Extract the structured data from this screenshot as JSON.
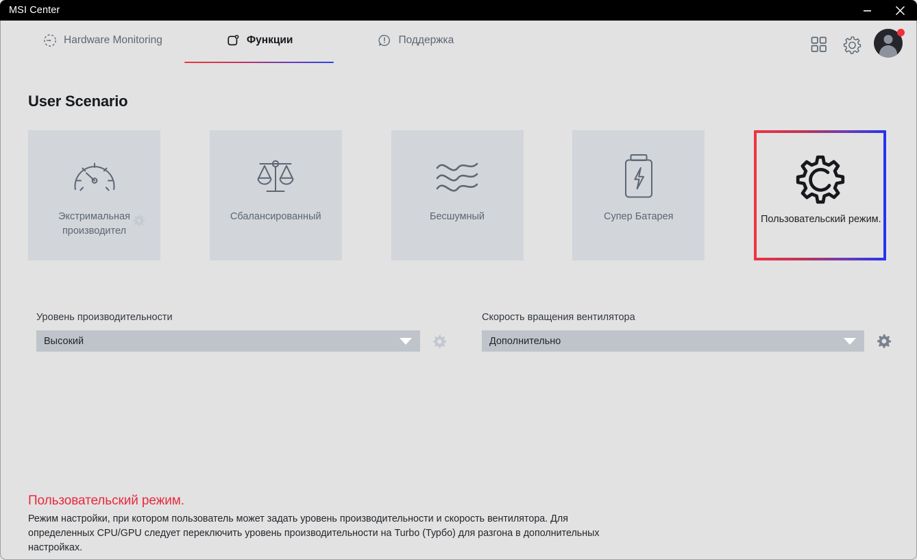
{
  "window": {
    "title": "MSI Center",
    "minimize_label": "minimize-icon",
    "close_label": "close-icon"
  },
  "nav": {
    "tabs": [
      {
        "label": "Hardware Monitoring",
        "icon": "gauge-dashed-icon",
        "active": false
      },
      {
        "label": "Функции",
        "icon": "features-icon",
        "active": true
      },
      {
        "label": "Поддержка",
        "icon": "support-bubble-icon",
        "active": false
      }
    ],
    "actions": [
      {
        "name": "apps-grid-icon",
        "label": "Apps"
      },
      {
        "name": "gear-icon",
        "label": "Settings"
      }
    ],
    "avatar": {
      "name": "avatar",
      "has_notification": true
    }
  },
  "main": {
    "section_title": "User Scenario",
    "cards": [
      {
        "label": "Экстримальная производител",
        "icon": "speedometer-icon",
        "selected": false,
        "has_gear": true
      },
      {
        "label": "Сбалансированный",
        "icon": "scales-balance-icon",
        "selected": false,
        "has_gear": false
      },
      {
        "label": "Бесшумный",
        "icon": "waves-icon",
        "selected": false,
        "has_gear": false
      },
      {
        "label": "Супер Батарея",
        "icon": "battery-bolt-icon",
        "selected": false,
        "has_gear": false
      },
      {
        "label": "Пользовательский режим.",
        "icon": "gear-outline-icon",
        "selected": true,
        "has_gear": false
      }
    ],
    "controls": [
      {
        "label": "Уровень производительности",
        "value": "Высокий",
        "gear_state": "disabled"
      },
      {
        "label": "Скорость вращения вентилятора",
        "value": "Дополнительно",
        "gear_state": "active"
      }
    ]
  },
  "footer": {
    "title": "Пользовательский режим.",
    "text": "Режим настройки, при котором пользователь может задать уровень производительности и скорость вентилятора. Для определенных CPU/GPU следует переключить уровень производительности на Turbo (Турбо) для разгона в дополнительных настройках."
  },
  "colors": {
    "accent_red": "#e8293f",
    "accent_blue": "#2433f0",
    "page_bg": "#e2e2e2",
    "card_bg": "#d2d5da",
    "select_bg": "#bfc4cb",
    "icon_gray": "#5c6773",
    "notification_dot": "#f02f3c"
  }
}
